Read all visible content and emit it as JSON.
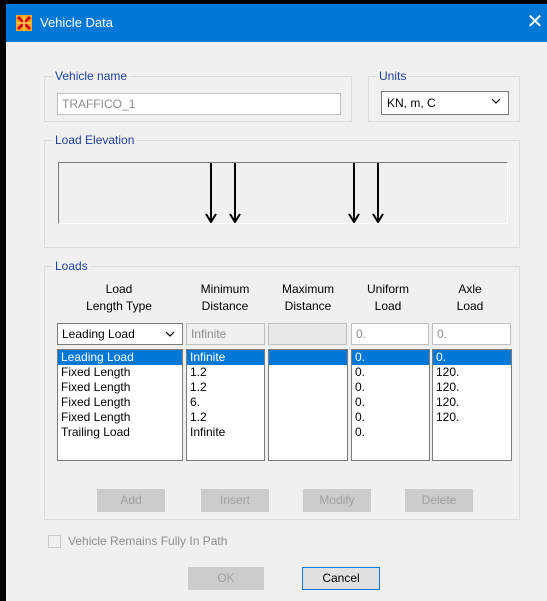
{
  "window": {
    "title": "Vehicle Data",
    "close_glyph": "✕"
  },
  "vehicle_name": {
    "label": "Vehicle name",
    "value": "TRAFFICO_1"
  },
  "units": {
    "label": "Units",
    "value": "KN, m, C"
  },
  "load_elevation": {
    "label": "Load Elevation"
  },
  "loads": {
    "label": "Loads",
    "headers": [
      {
        "line1": "Load",
        "line2": "Length Type"
      },
      {
        "line1": "Minimum",
        "line2": "Distance"
      },
      {
        "line1": "Maximum",
        "line2": "Distance"
      },
      {
        "line1": "Uniform",
        "line2": "Load"
      },
      {
        "line1": "Axle",
        "line2": "Load"
      }
    ],
    "edit_row": {
      "type": "Leading Load",
      "min_distance": "Infinite",
      "max_distance": "",
      "uniform_load": "0.",
      "axle_load": "0."
    },
    "rows": [
      {
        "type": "Leading Load",
        "min": "Infinite",
        "max": "",
        "uniform": "0.",
        "axle": "0."
      },
      {
        "type": "Fixed Length",
        "min": "1.2",
        "max": "",
        "uniform": "0.",
        "axle": "120."
      },
      {
        "type": "Fixed Length",
        "min": "1.2",
        "max": "",
        "uniform": "0.",
        "axle": "120."
      },
      {
        "type": "Fixed Length",
        "min": "6.",
        "max": "",
        "uniform": "0.",
        "axle": "120."
      },
      {
        "type": "Fixed Length",
        "min": "1.2",
        "max": "",
        "uniform": "0.",
        "axle": "120."
      },
      {
        "type": "Trailing Load",
        "min": "Infinite",
        "max": "",
        "uniform": "0.",
        "axle": ""
      }
    ],
    "selected_row": 0
  },
  "buttons": {
    "add": "Add",
    "insert": "Insert",
    "modify": "Modify",
    "delete": "Delete",
    "ok": "OK",
    "cancel": "Cancel"
  },
  "fully_in_path": {
    "label": "Vehicle Remains Fully In Path",
    "checked": false
  },
  "colors": {
    "title_bar": "#0078d7",
    "group_label": "#1e3f9a",
    "selection": "#0078d7"
  }
}
